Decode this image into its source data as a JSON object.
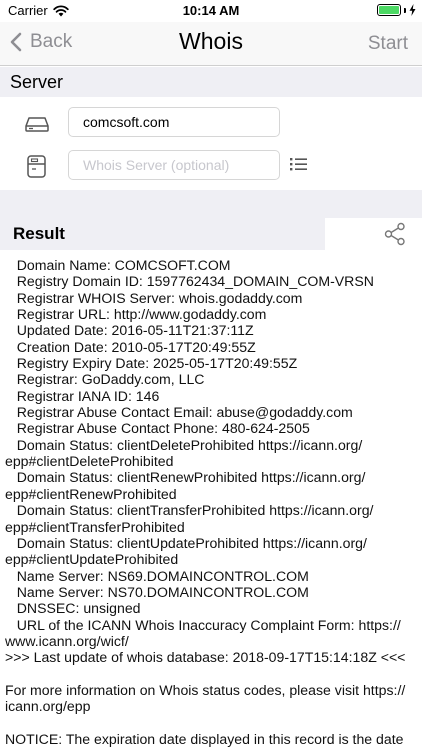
{
  "status_bar": {
    "carrier": "Carrier",
    "time": "10:14 AM"
  },
  "nav": {
    "back_label": "Back",
    "title": "Whois",
    "start_label": "Start"
  },
  "server": {
    "header": "Server",
    "domain_value": "comcsoft.com",
    "whois_server_placeholder": "Whois Server (optional)"
  },
  "result": {
    "header": "Result",
    "lines": [
      "   Domain Name: COMCSOFT.COM",
      "   Registry Domain ID: 1597762434_DOMAIN_COM-VRSN",
      "   Registrar WHOIS Server: whois.godaddy.com",
      "   Registrar URL: http://www.godaddy.com",
      "   Updated Date: 2016-05-11T21:37:11Z",
      "   Creation Date: 2010-05-17T20:49:55Z",
      "   Registry Expiry Date: 2025-05-17T20:49:55Z",
      "   Registrar: GoDaddy.com, LLC",
      "   Registrar IANA ID: 146",
      "   Registrar Abuse Contact Email: abuse@godaddy.com",
      "   Registrar Abuse Contact Phone: 480-624-2505",
      "   Domain Status: clientDeleteProhibited https://icann.org/",
      "epp#clientDeleteProhibited",
      "   Domain Status: clientRenewProhibited https://icann.org/",
      "epp#clientRenewProhibited",
      "   Domain Status: clientTransferProhibited https://icann.org/",
      "epp#clientTransferProhibited",
      "   Domain Status: clientUpdateProhibited https://icann.org/",
      "epp#clientUpdateProhibited",
      "   Name Server: NS69.DOMAINCONTROL.COM",
      "   Name Server: NS70.DOMAINCONTROL.COM",
      "   DNSSEC: unsigned",
      "   URL of the ICANN Whois Inaccuracy Complaint Form: https://",
      "www.icann.org/wicf/",
      ">>> Last update of whois database: 2018-09-17T15:14:18Z <<<",
      "",
      "For more information on Whois status codes, please visit https://",
      "icann.org/epp",
      "",
      "NOTICE: The expiration date displayed in this record is the date"
    ]
  },
  "colors": {
    "section_background": "#efeff4",
    "nav_text_gray": "#8e8e93",
    "battery_green": "#4cd964"
  },
  "icons": {
    "back": "chevron-left-icon",
    "wifi": "wifi-icon",
    "battery": "battery-icon",
    "charging": "charging-bolt-icon",
    "domain": "hard-drive-icon",
    "whois_server": "server-card-icon",
    "server_list": "list-icon",
    "share": "share-icon"
  }
}
